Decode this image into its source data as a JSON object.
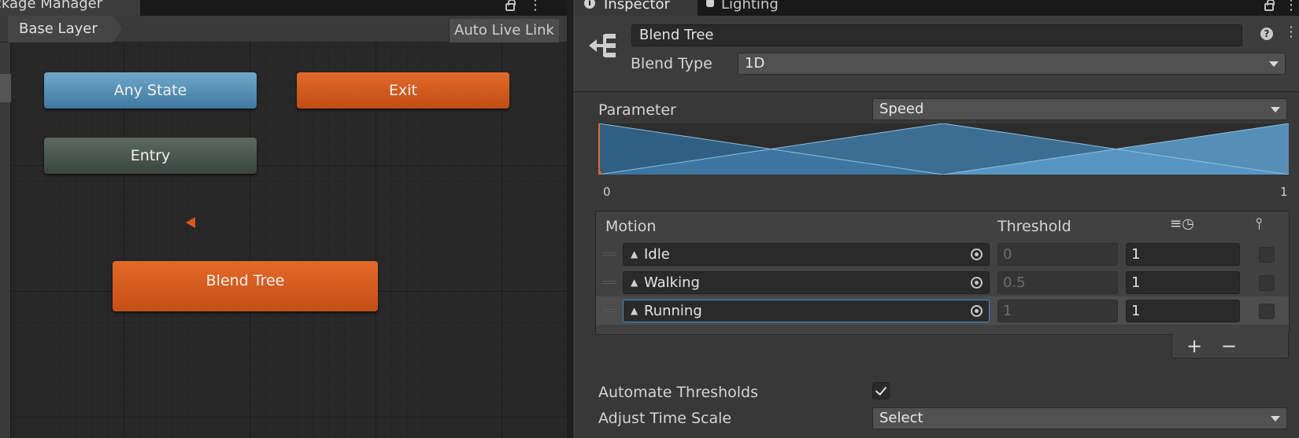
{
  "animator": {
    "tab_title": "ckage Manager",
    "breadcrumb": "Base Layer",
    "live_link_label": "Auto Live Link",
    "nodes": {
      "any_state": "Any State",
      "exit": "Exit",
      "entry": "Entry",
      "blend_tree": "Blend Tree"
    }
  },
  "inspector": {
    "tabs": {
      "inspector": "Inspector",
      "lighting": "Lighting"
    },
    "name": "Blend Tree",
    "blend_type_label": "Blend Type",
    "blend_type_value": "1D",
    "parameter_label": "Parameter",
    "parameter_value": "Speed",
    "axis_min": "0",
    "axis_max": "1",
    "table": {
      "headers": {
        "motion": "Motion",
        "threshold": "Threshold"
      },
      "rows": [
        {
          "motion": "Idle",
          "threshold": "0",
          "speed": "1",
          "selected": false
        },
        {
          "motion": "Walking",
          "threshold": "0.5",
          "speed": "1",
          "selected": false
        },
        {
          "motion": "Running",
          "threshold": "1",
          "speed": "1",
          "selected": true
        }
      ]
    },
    "add_label": "+",
    "remove_label": "−",
    "automate_label": "Automate Thresholds",
    "automate_checked": true,
    "adjust_label": "Adjust Time Scale",
    "adjust_value": "Select"
  },
  "colors": {
    "state_orange": "#c44f17",
    "any_state_blue": "#3e78a0",
    "entry_green": "#3a4440",
    "selection_blue": "#3d8fd6"
  },
  "icons": [
    "lock-icon",
    "kebab-icon",
    "info-icon",
    "bulb-icon",
    "blend-tree-icon",
    "help-icon",
    "animation-clip-icon",
    "object-picker-icon",
    "speed-icon",
    "mirror-icon"
  ]
}
